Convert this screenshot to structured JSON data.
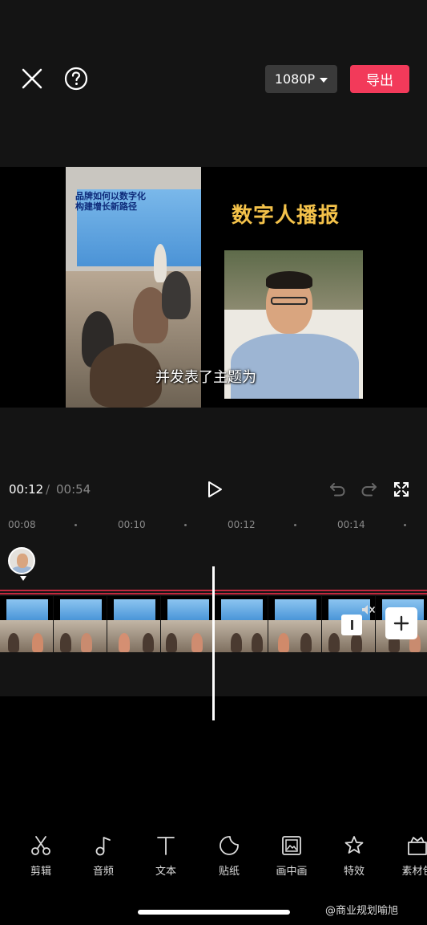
{
  "header": {
    "resolution_label": "1080P",
    "export_label": "导出"
  },
  "preview": {
    "slide_title_line1": "品牌如何以数字化",
    "slide_title_line2": "构建增长新路径",
    "headline": "数字人播报",
    "subtitle": "并发表了主题为"
  },
  "playback": {
    "current_time": "00:12",
    "separator": "/",
    "total_time": "00:54"
  },
  "timeline": {
    "ticks": [
      "00:08",
      "00:10",
      "00:12",
      "00:14"
    ]
  },
  "toolbar": {
    "items": [
      {
        "label": "剪辑",
        "icon": "scissors-icon"
      },
      {
        "label": "音频",
        "icon": "music-note-icon"
      },
      {
        "label": "文本",
        "icon": "text-icon"
      },
      {
        "label": "贴纸",
        "icon": "sticker-icon"
      },
      {
        "label": "画中画",
        "icon": "picture-in-picture-icon"
      },
      {
        "label": "特效",
        "icon": "effects-star-icon"
      },
      {
        "label": "素材包",
        "icon": "material-pack-icon"
      }
    ]
  },
  "watermark": "@商业规划喻旭",
  "colors": {
    "accent": "#f23a5a",
    "headline": "#f4c24a",
    "track_line": "#c3293e"
  }
}
